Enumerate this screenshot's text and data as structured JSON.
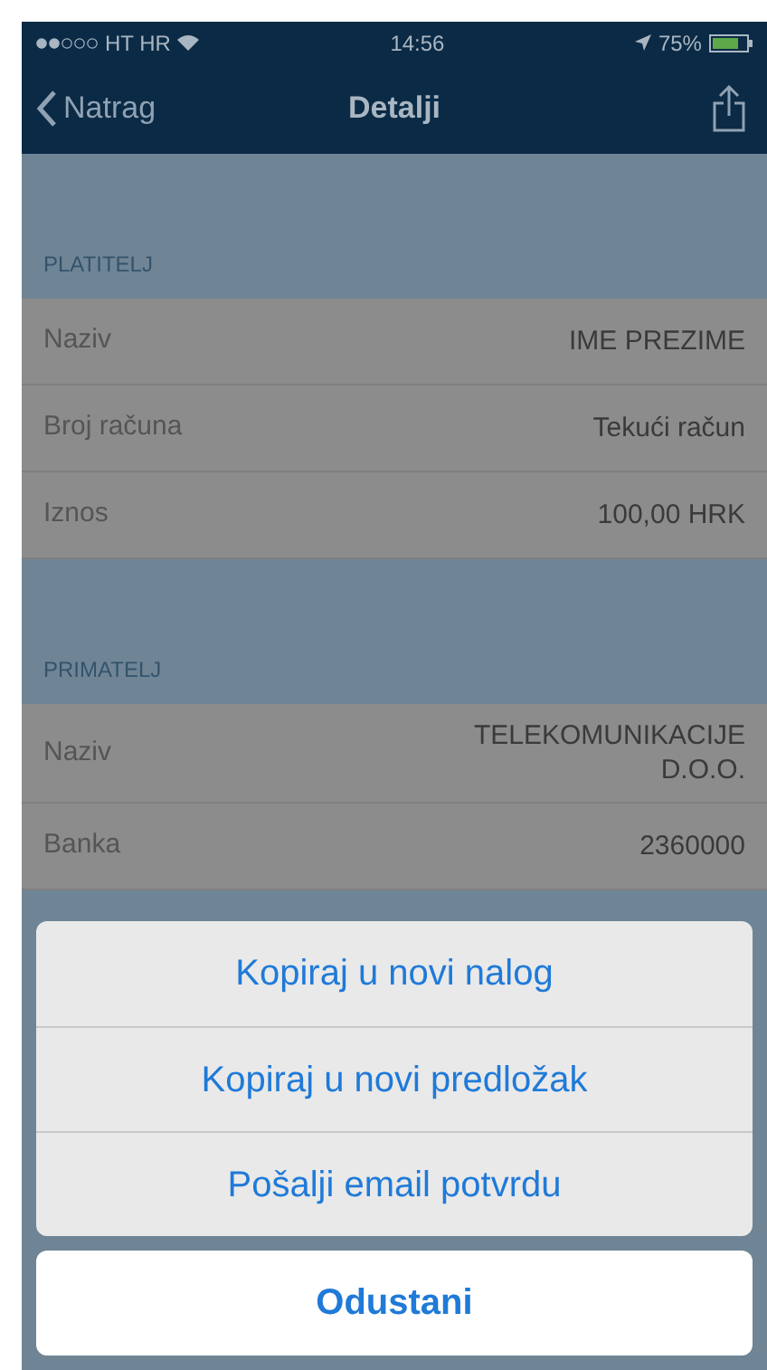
{
  "status_bar": {
    "carrier": "HT HR",
    "time": "14:56",
    "battery": "75%"
  },
  "nav_bar": {
    "back": "Natrag",
    "title": "Detalji"
  },
  "sections": [
    {
      "header": "PLATITELJ",
      "rows": [
        {
          "label": "Naziv",
          "value": "IME PREZIME"
        },
        {
          "label": "Broj računa",
          "value": "Tekući račun"
        },
        {
          "label": "Iznos",
          "value": "100,00 HRK"
        }
      ]
    },
    {
      "header": "PRIMATELJ",
      "rows": [
        {
          "label": "Naziv",
          "value": "TELEKOMUNIKACIJE D.O.O."
        },
        {
          "label": "Banka",
          "value": "2360000"
        }
      ]
    }
  ],
  "action_sheet": {
    "actions": [
      "Kopiraj u novi nalog",
      "Kopiraj u novi predložak",
      "Pošalji email potvrdu"
    ],
    "cancel": "Odustani"
  }
}
